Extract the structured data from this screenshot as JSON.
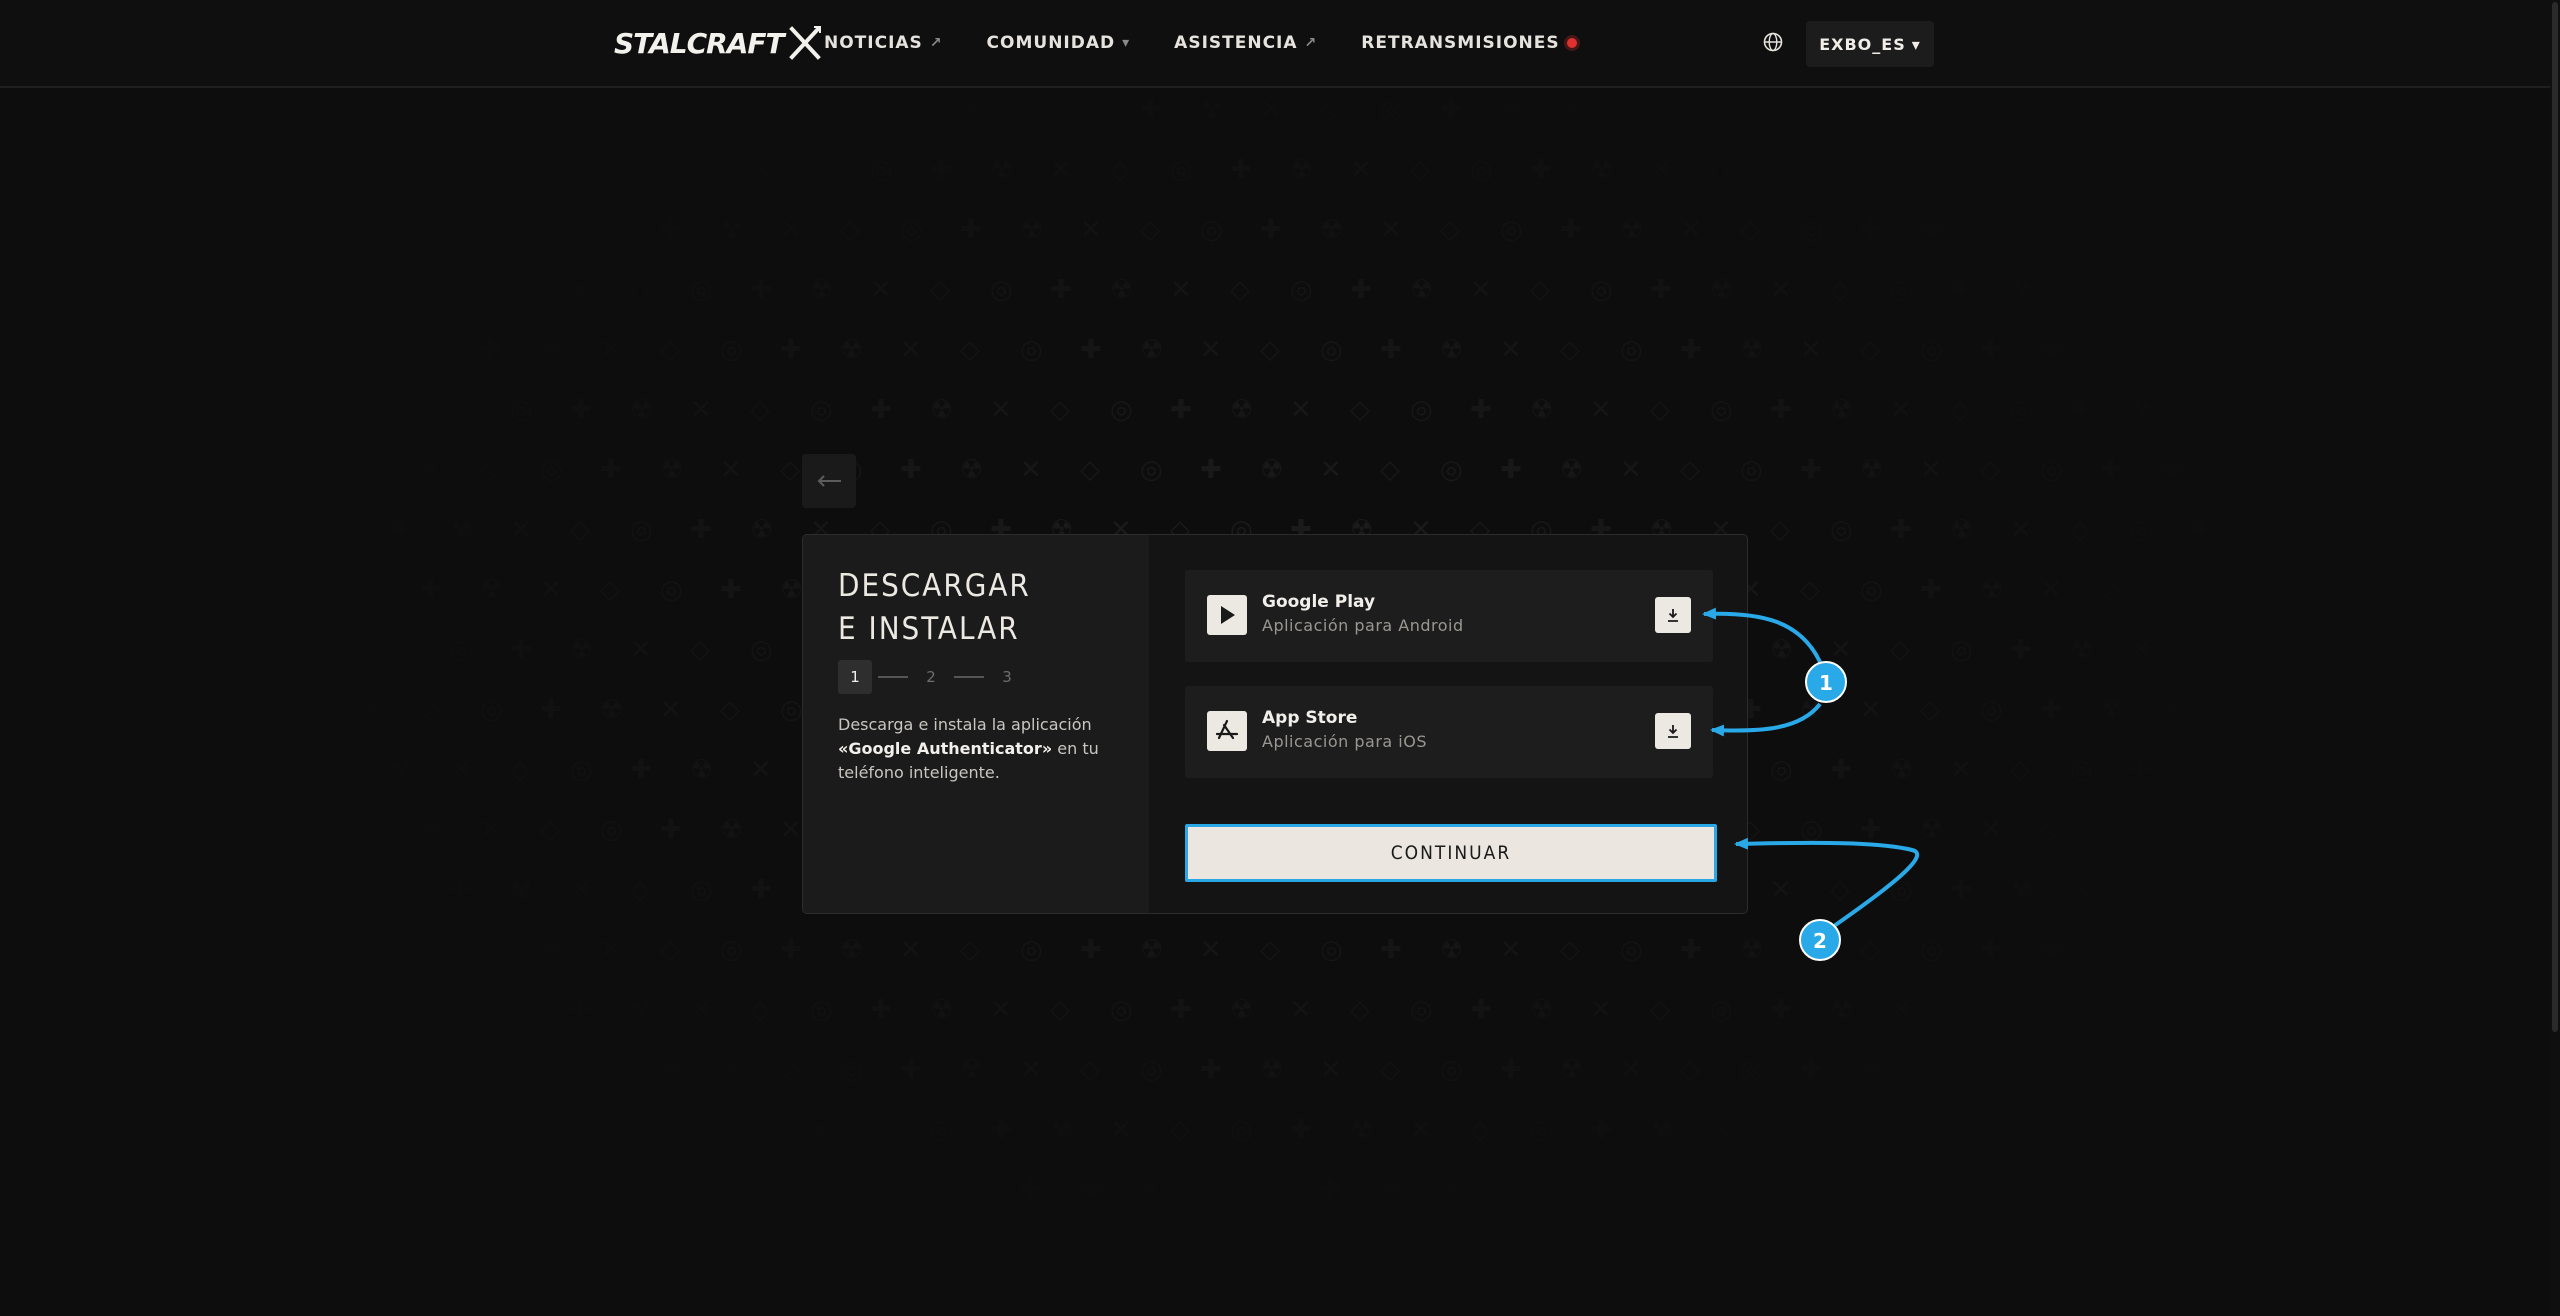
{
  "header": {
    "logo_text": "STALCRAFT",
    "nav": [
      {
        "label": "NOTICIAS",
        "suffix": "↗"
      },
      {
        "label": "COMUNIDAD",
        "suffix": "▾"
      },
      {
        "label": "ASISTENCIA",
        "suffix": "↗"
      },
      {
        "label": "RETRANSMISIONES",
        "suffix": "live-dot"
      }
    ],
    "globe_icon": "globe-icon",
    "account_label": "EXBO_ES",
    "account_caret": "▾"
  },
  "back": {
    "icon": "←"
  },
  "card": {
    "title_line1": "DESCARGAR",
    "title_line2": "E INSTALAR",
    "steps": [
      "1",
      "2",
      "3"
    ],
    "active_step": 1,
    "desc_part1": "Descarga e instala la aplicación ",
    "desc_bold": "«Google Authenticator»",
    "desc_part2": " en tu teléfono inteligente.",
    "stores": [
      {
        "name": "Google Play",
        "subtitle": "Aplicación para Android",
        "icon": "play-icon"
      },
      {
        "name": "App Store",
        "subtitle": "Aplicación para iOS",
        "icon": "app-store-icon"
      }
    ],
    "continue_label": "CONTINUAR"
  },
  "annotations": [
    {
      "number": "1",
      "color": "#29a9e8"
    },
    {
      "number": "2",
      "color": "#29a9e8"
    }
  ],
  "colors": {
    "background": "#0d0d0d",
    "accent": "#29a9e8",
    "live": "#e03131",
    "button": "#ebe6e0"
  }
}
